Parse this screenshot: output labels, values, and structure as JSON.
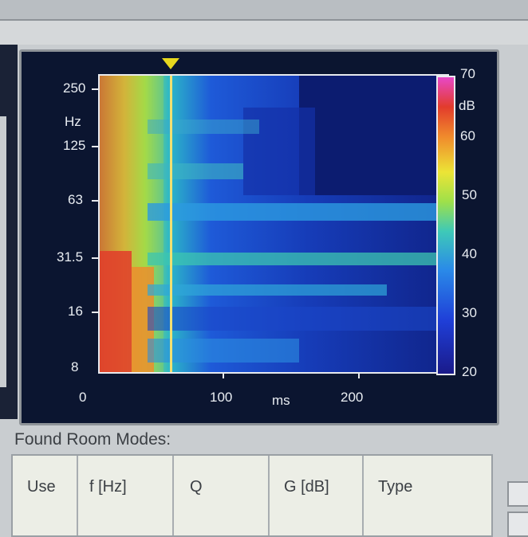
{
  "plot": {
    "y_axis": {
      "unit": "Hz",
      "ticks": [
        "250",
        "125",
        "63",
        "31.5",
        "16",
        "8"
      ]
    },
    "x_axis": {
      "unit": "ms",
      "ticks": [
        "0",
        "100",
        "200"
      ]
    },
    "colorbar": {
      "unit": "dB",
      "ticks": [
        "70",
        "60",
        "50",
        "40",
        "30",
        "20"
      ]
    }
  },
  "room_modes": {
    "title": "Found Room Modes:",
    "columns": [
      "Use",
      "f [Hz]",
      "Q",
      "G [dB]",
      "Type"
    ]
  }
}
